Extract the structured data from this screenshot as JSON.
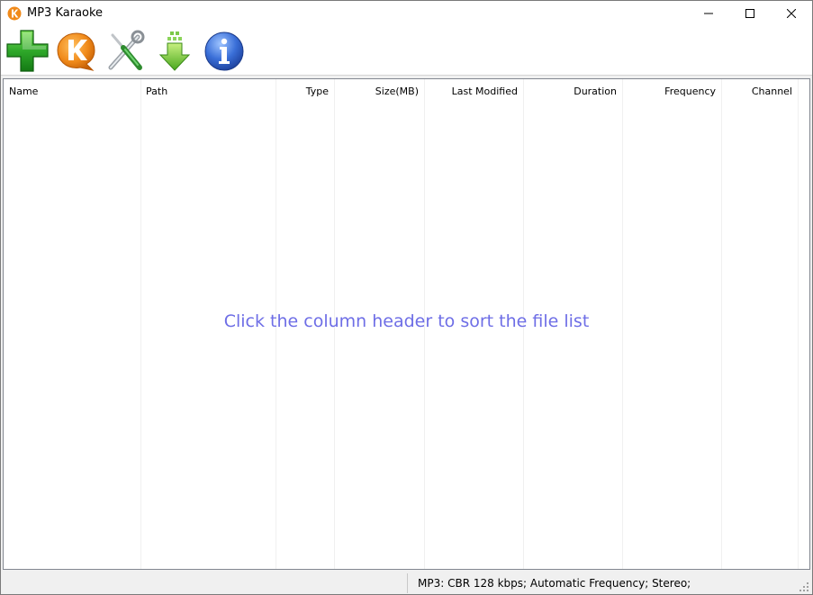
{
  "window": {
    "title": "MP3 Karaoke"
  },
  "toolbar": {
    "buttons": [
      {
        "name": "add-files",
        "icon": "green-plus-icon"
      },
      {
        "name": "karaoke",
        "icon": "karaoke-k-icon"
      },
      {
        "name": "settings",
        "icon": "tools-icon"
      },
      {
        "name": "download",
        "icon": "download-arrow-icon"
      },
      {
        "name": "about",
        "icon": "info-icon"
      }
    ]
  },
  "list": {
    "columns": [
      "Name",
      "Path",
      "Type",
      "Size(MB)",
      "Last Modified",
      "Duration",
      "Frequency",
      "Channel"
    ],
    "empty_message": "Click the column header to sort the file list",
    "rows": []
  },
  "status": {
    "text": "MP3:  CBR 128 kbps; Automatic Frequency; Stereo;"
  },
  "colors": {
    "accent_text": "#6e6ee6",
    "karaoke_orange": "#f08a1a",
    "info_blue": "#3a6fd8"
  }
}
